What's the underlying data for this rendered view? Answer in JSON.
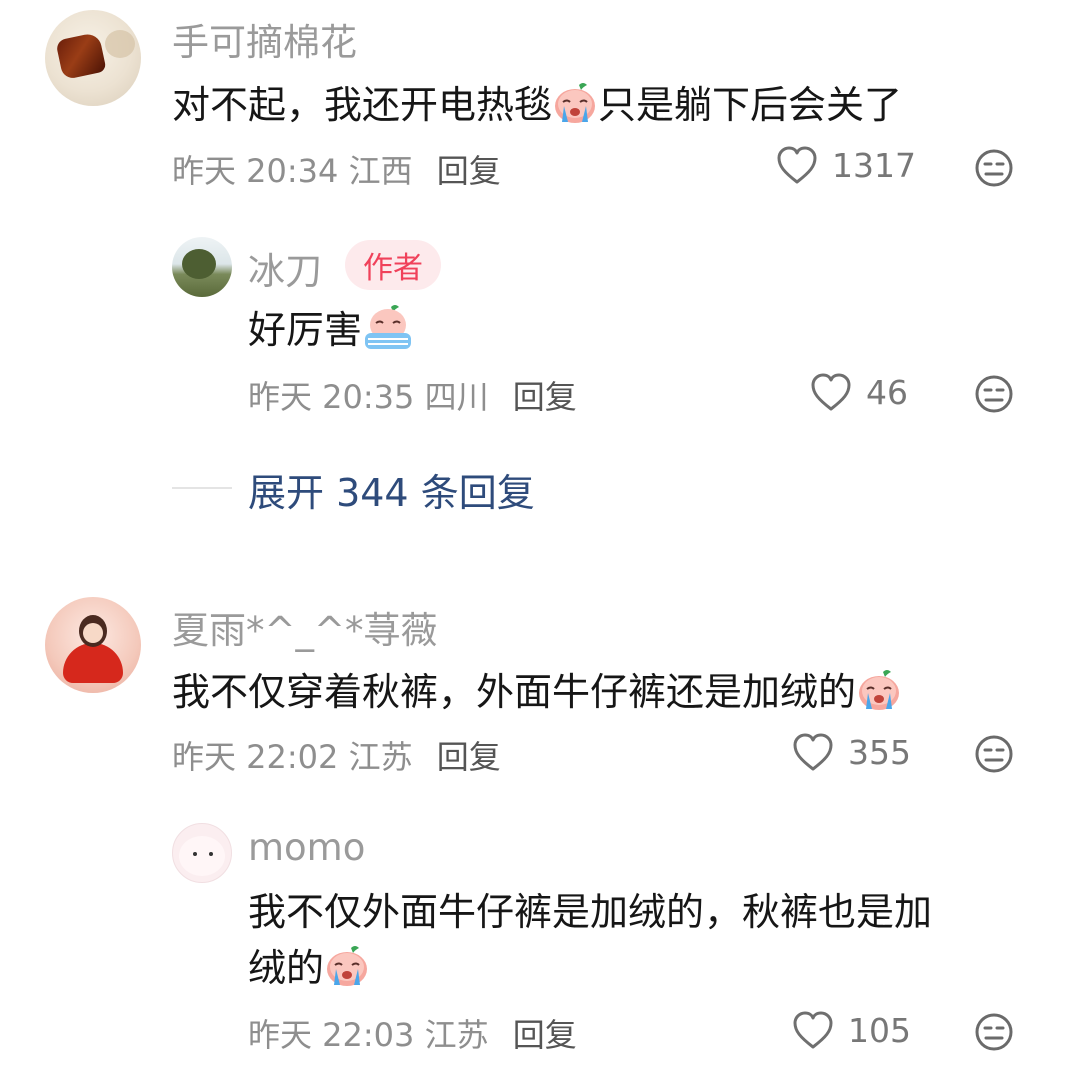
{
  "comments": [
    {
      "username": "手可摘棉花",
      "text_before": "对不起，我还开电热毯",
      "text_after": "只是躺下后会关了",
      "time": "昨天 20:34",
      "location": "江西",
      "reply_label": "回复",
      "likes": "1317",
      "replies": [
        {
          "username": "冰刀",
          "badge": "作者",
          "text_before": "好厉害",
          "time": "昨天 20:35",
          "location": "四川",
          "reply_label": "回复",
          "likes": "46"
        }
      ],
      "expand_label": "展开 344 条回复"
    },
    {
      "username": "夏雨*^_^*荨薇",
      "text_before": "我不仅穿着秋裤，外面牛仔裤还是加绒的",
      "time": "昨天 22:02",
      "location": "江苏",
      "reply_label": "回复",
      "likes": "355",
      "replies": [
        {
          "username": "momo",
          "text_line1": "我不仅外面牛仔裤是加绒的，秋裤也是加",
          "text_line2": "绒的",
          "time": "昨天 22:03",
          "location": "江苏",
          "reply_label": "回复",
          "likes": "105"
        }
      ]
    }
  ],
  "icons": {
    "like": "heart-outline-icon",
    "more": "meh-face-icon",
    "emoji_cry": "crying-face-emoji"
  },
  "colors": {
    "badge_bg": "#fdeaec",
    "badge_text": "#f0415a",
    "expand_text": "#2e4b7b"
  }
}
